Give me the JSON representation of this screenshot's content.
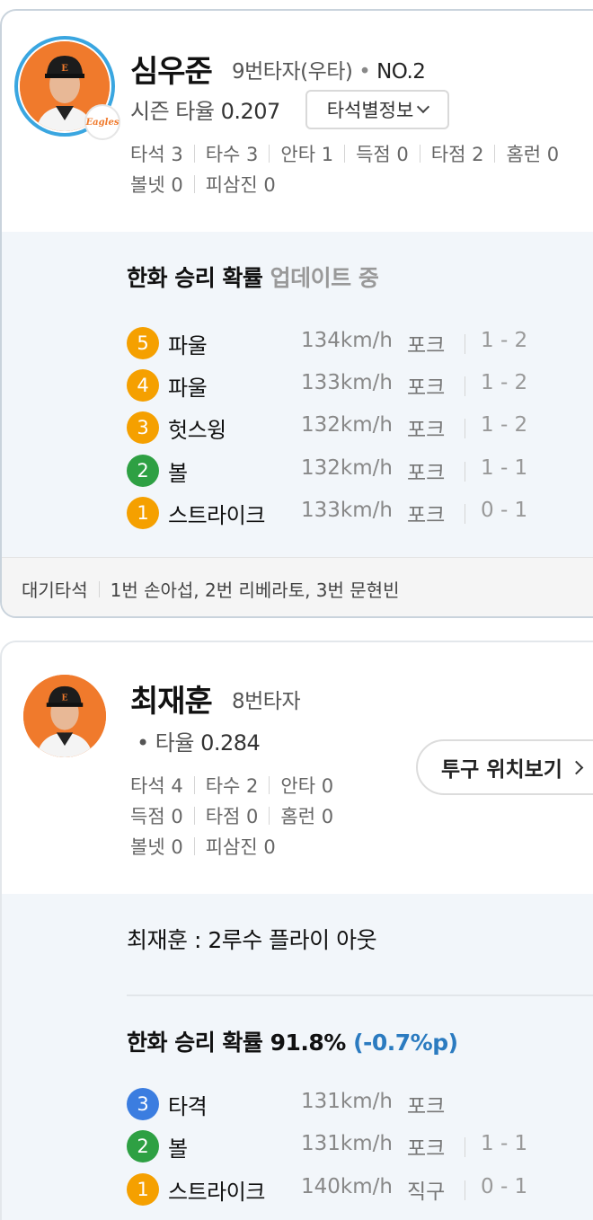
{
  "colors": {
    "orange": "#f5a000",
    "green": "#2ea043",
    "blue": "#3b7de0",
    "accent": "#2b7bc0"
  },
  "batter1": {
    "name": "심우준",
    "order": "9번타자(우타)",
    "dot": "•",
    "number": "NO.2",
    "team_logo_text": "Eagles",
    "season_avg_label": "시즌 타율",
    "season_avg": "0.207",
    "dropdown_label": "타석별정보",
    "stats": [
      "타석 3",
      "타수 3",
      "안타 1",
      "득점 0",
      "타점 2",
      "홈런 0"
    ],
    "stats2": [
      "볼넷 0",
      "피삼진 0"
    ],
    "win_prob_label": "한화 승리 확률",
    "win_prob_status": "업데이트 중",
    "pitches": [
      {
        "n": "5",
        "result": "파울",
        "speed": "134km/h",
        "type": "포크",
        "count": "1 - 2",
        "color": "orange"
      },
      {
        "n": "4",
        "result": "파울",
        "speed": "133km/h",
        "type": "포크",
        "count": "1 - 2",
        "color": "orange"
      },
      {
        "n": "3",
        "result": "헛스윙",
        "speed": "132km/h",
        "type": "포크",
        "count": "1 - 2",
        "color": "orange"
      },
      {
        "n": "2",
        "result": "볼",
        "speed": "132km/h",
        "type": "포크",
        "count": "1 - 1",
        "color": "green"
      },
      {
        "n": "1",
        "result": "스트라이크",
        "speed": "133km/h",
        "type": "포크",
        "count": "0 - 1",
        "color": "orange"
      }
    ],
    "waiting_label": "대기타석",
    "waiting_list": "1번 손아섭, 2번 리베라토, 3번 문현빈"
  },
  "batter2": {
    "name": "최재훈",
    "order": "8번타자",
    "avg_prefix": "• 타율",
    "avg": "0.284",
    "location_button": "투구 위치보기",
    "stats": [
      "타석 4",
      "타수 2",
      "안타 0"
    ],
    "stats2": [
      "득점 0",
      "타점 0",
      "홈런 0"
    ],
    "stats3": [
      "볼넷 0",
      "피삼진 0"
    ],
    "result_text": "최재훈 : 2루수 플라이 아웃",
    "win_prob_label": "한화 승리 확률 91.8%",
    "win_prob_delta": "(-0.7%p)",
    "pitches": [
      {
        "n": "3",
        "result": "타격",
        "speed": "131km/h",
        "type": "포크",
        "count": "",
        "color": "blue"
      },
      {
        "n": "2",
        "result": "볼",
        "speed": "131km/h",
        "type": "포크",
        "count": "1 - 1",
        "color": "green"
      },
      {
        "n": "1",
        "result": "스트라이크",
        "speed": "140km/h",
        "type": "직구",
        "count": "0 - 1",
        "color": "orange"
      }
    ]
  }
}
